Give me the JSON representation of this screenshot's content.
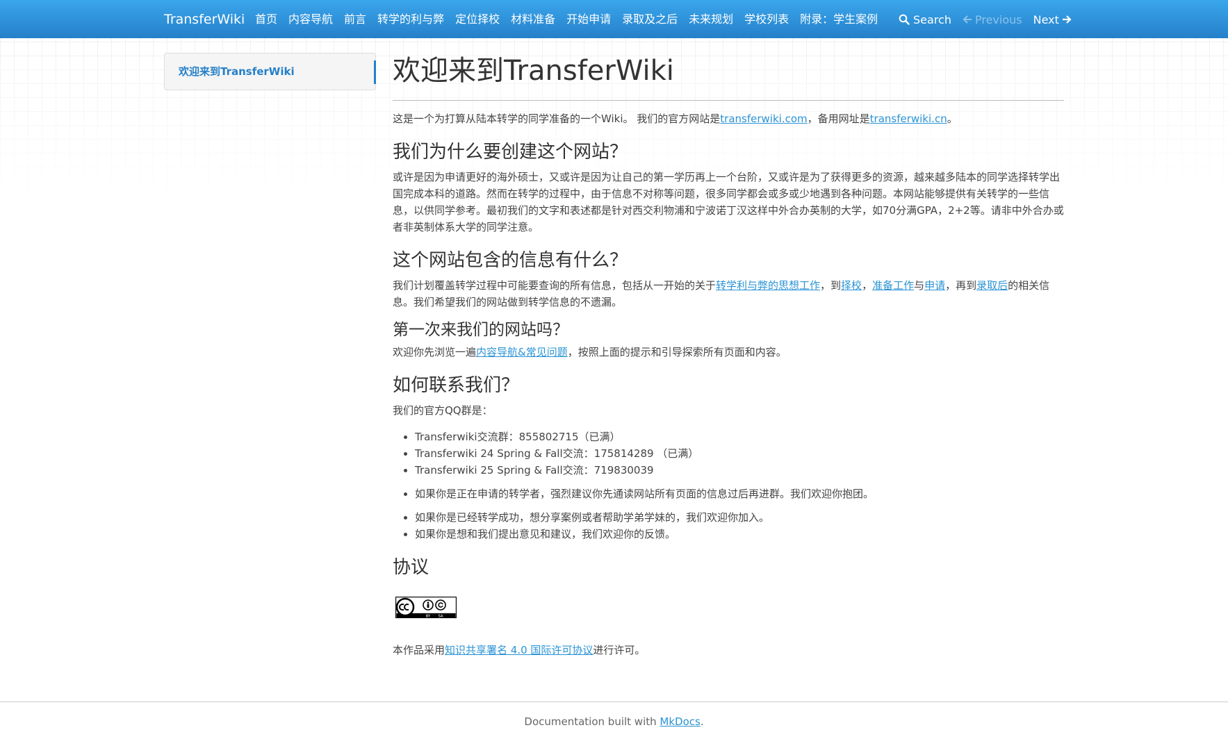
{
  "nav": {
    "brand": "TransferWiki",
    "items": [
      {
        "label": "首页"
      },
      {
        "label": "内容导航"
      },
      {
        "label": "前言"
      },
      {
        "label": "转学的利与弊"
      },
      {
        "label": "定位择校"
      },
      {
        "label": "材料准备"
      },
      {
        "label": "开始申请"
      },
      {
        "label": "录取及之后"
      },
      {
        "label": "未来规划"
      },
      {
        "label": "学校列表"
      },
      {
        "label": "附录：学生案例"
      }
    ],
    "search_label": "Search",
    "previous_label": "Previous",
    "next_label": "Next",
    "bar_color": "#2c8fd8"
  },
  "sidebar": {
    "items": [
      {
        "label": "欢迎来到TransferWiki"
      }
    ]
  },
  "main": {
    "title": "欢迎来到TransferWiki",
    "intro": {
      "before": "这是一个为打算从陆本转学的同学准备的一个Wiki。 我们的官方网站是",
      "link1": "transferwiki.com",
      "middle": "，备用网址是",
      "link2": "transferwiki.cn",
      "after": "。"
    },
    "why": {
      "heading": "我们为什么要创建这个网站？",
      "text": "或许是因为申请更好的海外硕士，又或许是因为让自己的第一学历再上一个台阶，又或许是为了获得更多的资源，越来越多陆本的同学选择转学出国完成本科的道路。然而在转学的过程中，由于信息不对称等问题，很多同学都会或多或少地遇到各种问题。本网站能够提供有关转学的一些信息，以供同学参考。最初我们的文字和表述都是针对西交利物浦和宁波诺丁汉这样中外合办英制的大学，如70分满GPA，2+2等。请非中外合办或者非英制体系大学的同学注意。"
    },
    "contents": {
      "heading": "这个网站包含的信息有什么？",
      "p1": "我们计划覆盖转学过程中可能要查询的所有信息，包括从一开始的关于",
      "link_pros": "转学利与弊的思想工作",
      "p2": "，到",
      "link_school": "择校",
      "p3": "，",
      "link_prep": "准备工作",
      "p4": "与",
      "link_apply": "申请",
      "p5": "，再到",
      "link_admit": "录取后",
      "p6": "的相关信息。我们希望我们的网站做到转学信息的不遗漏。"
    },
    "first_time": {
      "heading": "第一次来我们的网站吗？",
      "p1": "欢迎你先浏览一遍",
      "link": "内容导航&常见问题",
      "p2": "，按照上面的提示和引导探索所有页面和内容。"
    },
    "contact": {
      "heading": "如何联系我们？",
      "intro": "我们的官方QQ群是：",
      "groups": [
        "Transferwiki交流群：855802715（已满）",
        "Transferwiki 24 Spring & Fall交流：175814289 （已满）",
        "Transferwiki 25 Spring & Fall交流：719830039"
      ],
      "note1": "如果你是正在申请的转学者，强烈建议你先通读网站所有页面的信息过后再进群。我们欢迎你抱团。",
      "note2": "如果你是已经转学成功，想分享案例或者帮助学弟学妹的，我们欢迎你加入。",
      "note3": "如果你是想和我们提出意见和建议，我们欢迎你的反馈。"
    },
    "license": {
      "heading": "协议",
      "badge_icon": "cc-by-sa-badge-icon",
      "p1": "本作品采用",
      "link": "知识共享署名 4.0 国际许可协议",
      "p2": "进行许可。"
    }
  },
  "footer": {
    "text": "Documentation built with ",
    "link": "MkDocs",
    "after": "."
  }
}
